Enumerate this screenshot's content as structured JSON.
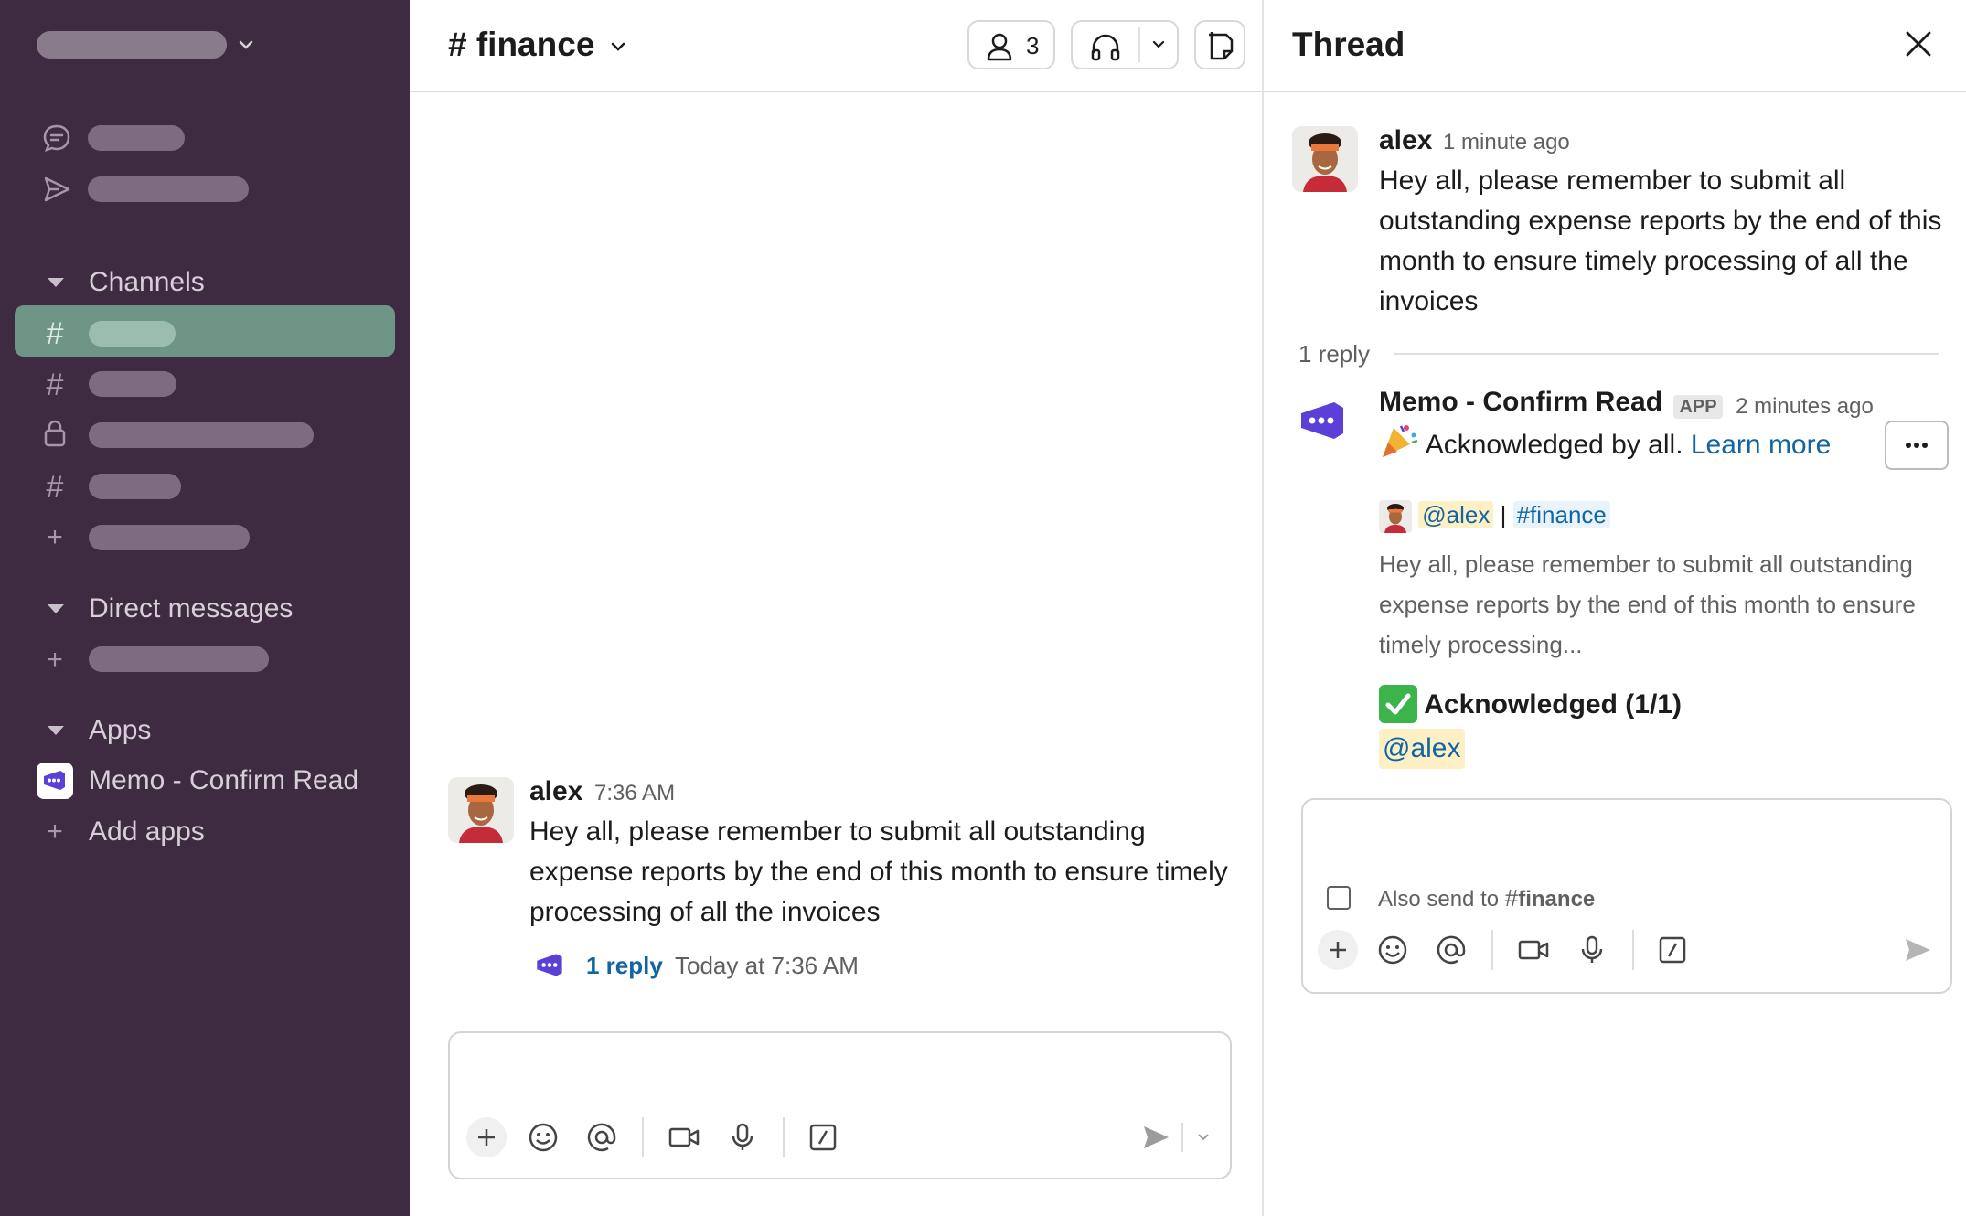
{
  "sidebar": {
    "sections": {
      "channels": "Channels",
      "direct_messages": "Direct messages",
      "apps": "Apps"
    },
    "apps": {
      "memo_app": "Memo - Confirm Read",
      "add_apps": "Add apps"
    },
    "icons": [
      "threads-icon",
      "send-icon",
      "hash-icon",
      "lock-icon",
      "plus-icon"
    ]
  },
  "channel": {
    "title": "# finance",
    "member_count": "3"
  },
  "main_message": {
    "author": "alex",
    "time": "7:36 AM",
    "text": "Hey all, please remember to submit all outstanding expense reports by the end of this month to ensure timely processing of all the invoices",
    "reply_link": "1 reply",
    "reply_time": "Today at 7:36 AM"
  },
  "thread": {
    "title": "Thread",
    "parent": {
      "author": "alex",
      "time": "1 minute ago",
      "text": "Hey all, please remember to submit all outstanding expense reports by the end of this month to ensure timely processing of all the invoices"
    },
    "reply_count": "1 reply",
    "reply": {
      "author": "Memo - Confirm Read",
      "badge": "APP",
      "time": "2 minutes ago",
      "text": "Acknowledged by all.",
      "learn_more": "Learn more",
      "quote_mention": "@alex",
      "quote_separator": "|",
      "quote_channel": "#finance",
      "quote_text": "Hey all, please remember to submit all outstanding expense reports by the end of this month to ensure timely processing...",
      "ack_title": "Acknowledged (1/1)",
      "ack_user": "@alex"
    },
    "composer": {
      "also_send_prefix": "Also send to",
      "also_send_channel": "finance"
    }
  },
  "colors": {
    "sidebar_bg": "#3f2b41",
    "active_channel": "#6e9585",
    "link": "#1264a3",
    "app_purple": "#5b3fd6"
  }
}
